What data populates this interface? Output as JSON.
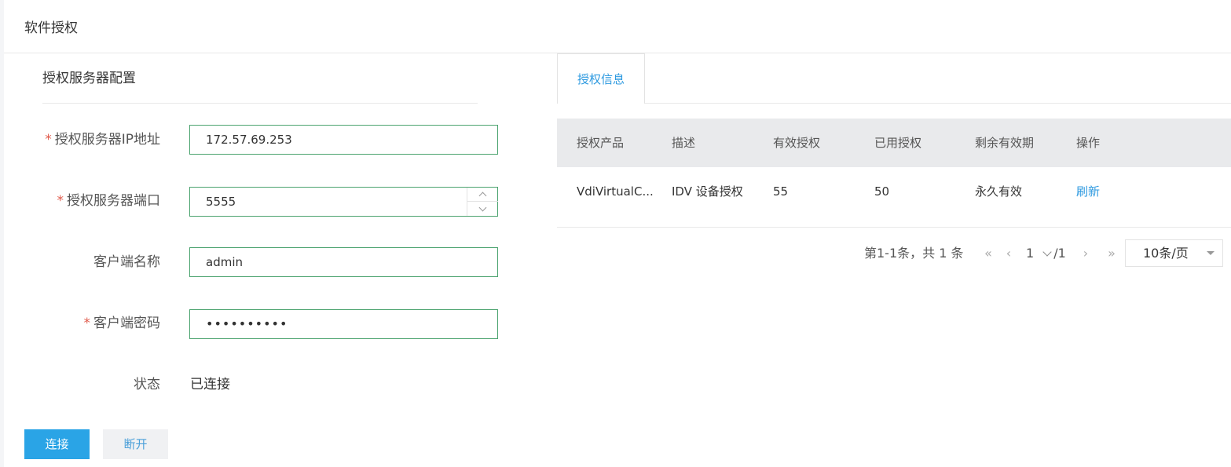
{
  "page": {
    "title": "软件授权"
  },
  "config": {
    "section_title": "授权服务器配置",
    "fields": {
      "ip": {
        "label": "授权服务器IP地址",
        "required": true,
        "value": "172.57.69.253"
      },
      "port": {
        "label": "授权服务器端口",
        "required": true,
        "value": "5555"
      },
      "client_name": {
        "label": "客户端名称",
        "required": false,
        "value": "admin"
      },
      "client_password": {
        "label": "客户端密码",
        "required": true,
        "value": "••••••••••"
      }
    },
    "status": {
      "label": "状态",
      "value": "已连接"
    },
    "buttons": {
      "connect": "连接",
      "disconnect": "断开"
    }
  },
  "license": {
    "tab_label": "授权信息",
    "columns": [
      "授权产品",
      "描述",
      "有效授权",
      "已用授权",
      "剩余有效期",
      "操作"
    ],
    "rows": [
      {
        "product": "VdiVirtualC...",
        "description": "IDV 设备授权",
        "valid": "55",
        "used": "50",
        "remaining": "永久有效",
        "action": "刷新"
      }
    ],
    "pagination": {
      "summary": "第1-1条，共 1 条",
      "current_page": "1",
      "total_pages": "/1",
      "page_size": "10条/页"
    }
  },
  "colors": {
    "primary": "#2aa4e6",
    "link": "#2e9ae0",
    "required": "#e05a4b",
    "input_border": "#4ba36f"
  },
  "icons": {
    "first": "double-chevron-left-icon",
    "prev": "chevron-left-icon",
    "next": "chevron-right-icon",
    "last": "double-chevron-right-icon"
  }
}
